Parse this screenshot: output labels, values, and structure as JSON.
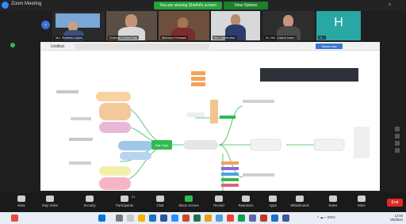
{
  "window": {
    "app_title": "Zoom Meeting",
    "share_banner": "You are viewing Shathil's screen",
    "view_options": "View Options",
    "top_right": "≡"
  },
  "participants": [
    {
      "name": "Md. Shahidul Islam"
    },
    {
      "name": "Subrata Kumar Das"
    },
    {
      "name": "Mahmud Hossain"
    },
    {
      "name": "Md. Habibullah"
    },
    {
      "name": "Dr. Md. Zakirul Islam"
    },
    {
      "name": "H..."
    }
  ],
  "h_avatar_letter": "H",
  "shared": {
    "doc_title": "Untitled",
    "button_label": "Share now"
  },
  "mindmap": {
    "center_label": "Main Topic"
  },
  "toolbar": [
    {
      "label": "Mute"
    },
    {
      "label": "Stop Video"
    },
    {
      "label": "Security"
    },
    {
      "label": "Participants"
    },
    {
      "label": "Chat"
    },
    {
      "label": "Share Screen"
    },
    {
      "label": "Record"
    },
    {
      "label": "Reactions"
    },
    {
      "label": "Apps"
    },
    {
      "label": "Whiteboards"
    },
    {
      "label": "Notes"
    },
    {
      "label": "More"
    }
  ],
  "participants_count": "21",
  "end_label": "End",
  "taskbar": {
    "tray_text": "^  ☁  ⌁  ENG",
    "time": "12:04",
    "date": "1/6/2024"
  },
  "colors": {
    "banner_green": "#27a33a",
    "end_red": "#e02828",
    "mindmap_green": "#2fbb4f"
  }
}
